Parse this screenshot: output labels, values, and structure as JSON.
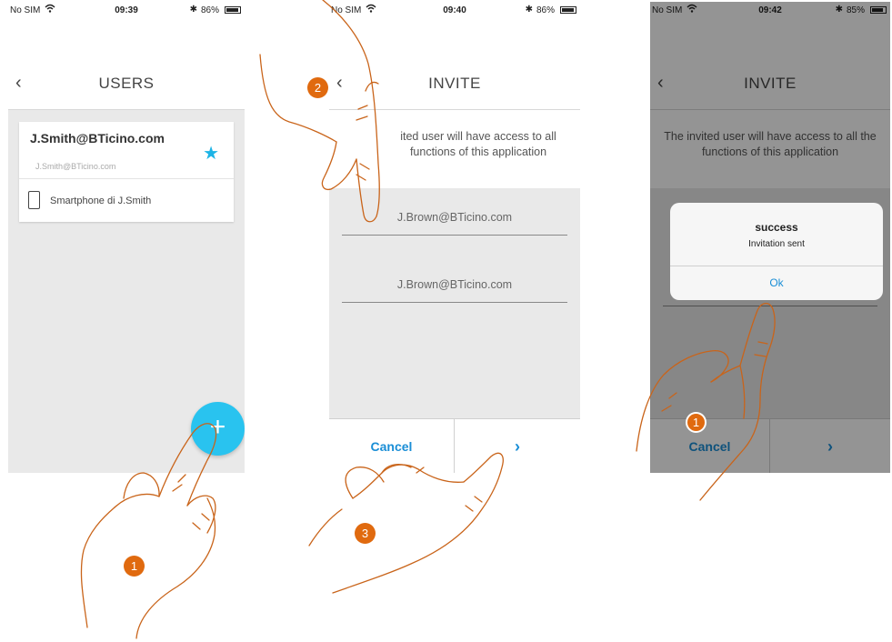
{
  "screens": [
    {
      "status": {
        "carrier": "No SIM",
        "time": "09:39",
        "battery": "86%",
        "battery_level": 0.86
      },
      "header": {
        "title": "USERS"
      },
      "user_card": {
        "email": "J.Smith@BTicino.com",
        "email_secondary": "J.Smith@BTicino.com",
        "device_label": "Smartphone di J.Smith"
      },
      "fab_label": "+"
    },
    {
      "status": {
        "carrier": "No SIM",
        "time": "09:40",
        "battery": "86%",
        "battery_level": 0.86
      },
      "header": {
        "title": "INVITE"
      },
      "info_text": "ited user will have access to all functions of this application",
      "fields": [
        {
          "value": "J.Brown@BTicino.com"
        },
        {
          "value": "J.Brown@BTicino.com"
        }
      ],
      "footer": {
        "cancel_label": "Cancel",
        "next_label": "›"
      }
    },
    {
      "status": {
        "carrier": "No SIM",
        "time": "09:42",
        "battery": "85%",
        "battery_level": 0.85
      },
      "header": {
        "title": "INVITE"
      },
      "info_text": "The invited user will have access to all the functions of this application",
      "dialog": {
        "title": "success",
        "message": "Invitation sent",
        "ok_label": "Ok"
      },
      "footer": {
        "cancel_label": "Cancel",
        "next_label": "›"
      }
    }
  ],
  "step_badges": [
    "1",
    "2",
    "3",
    "1"
  ],
  "colors": {
    "accent": "#29c3ef",
    "link_blue": "#1a8ed6",
    "badge_orange": "#e06a0f",
    "hand_outline": "#c9641a"
  }
}
